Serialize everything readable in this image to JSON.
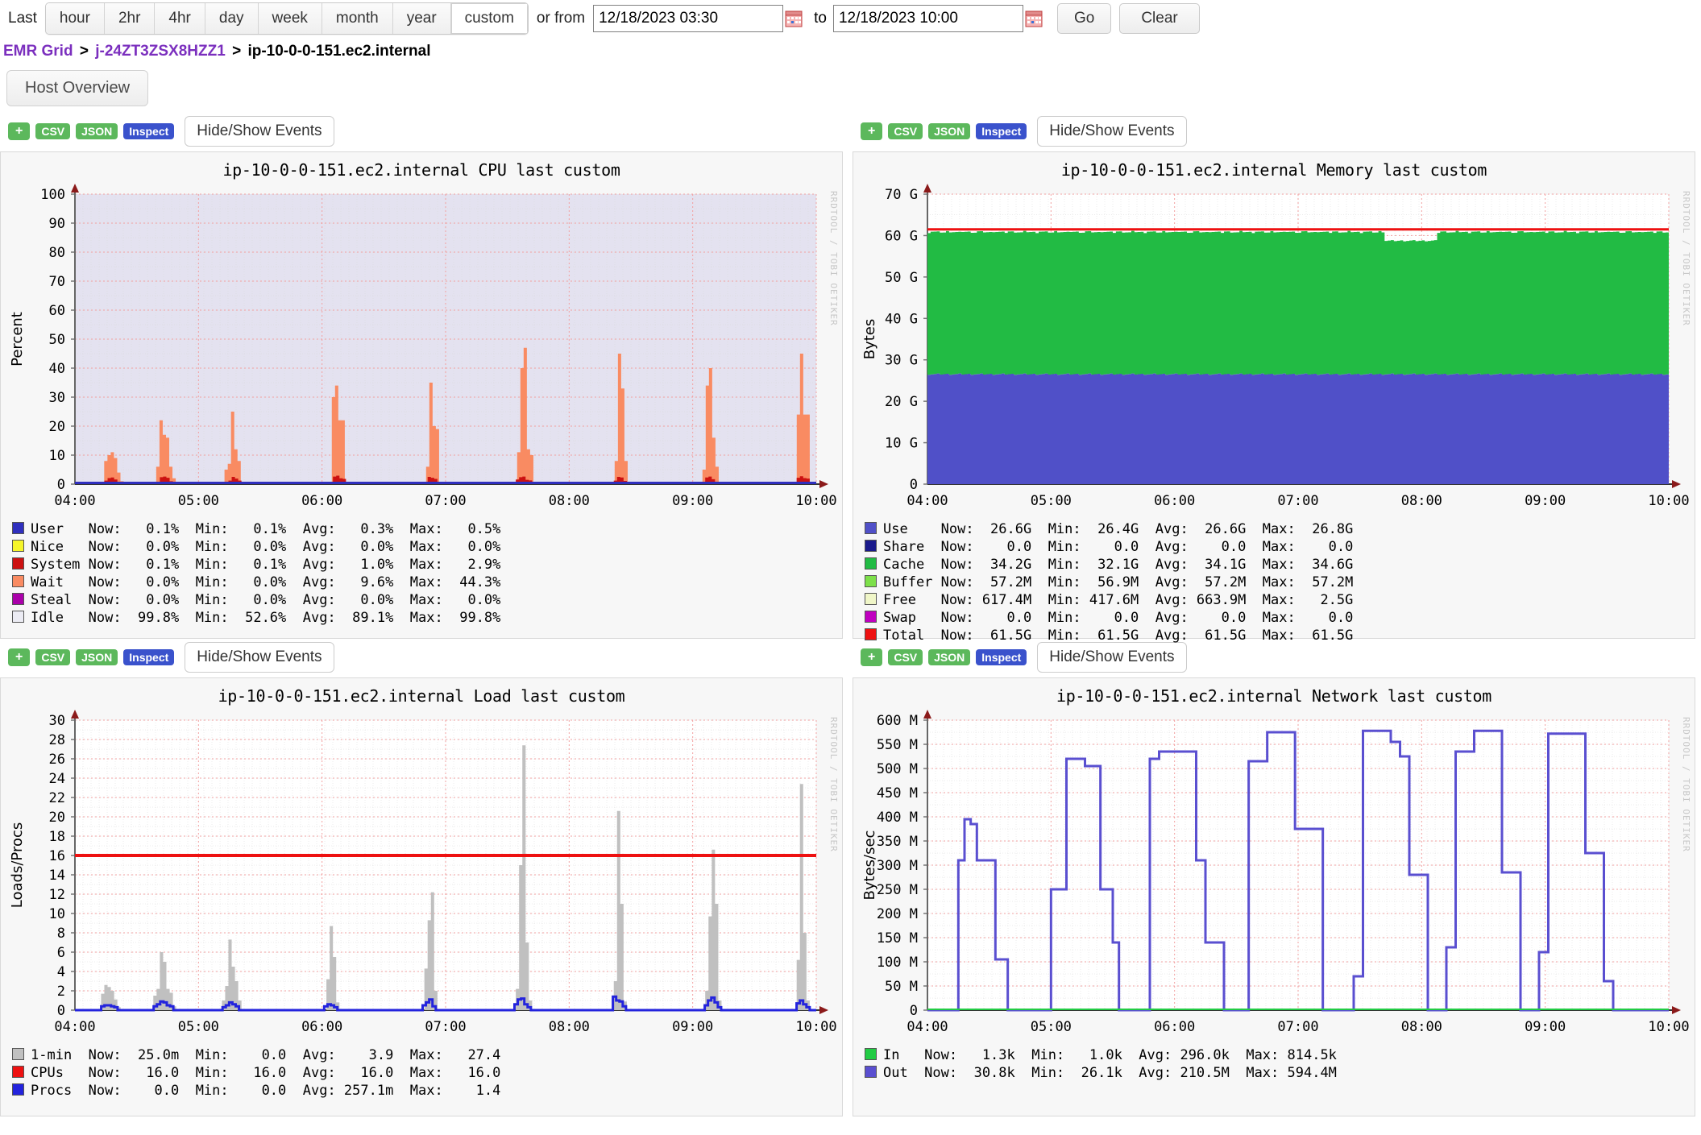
{
  "toolbar": {
    "last_label": "Last",
    "ranges": [
      {
        "id": "hour",
        "label": "hour",
        "active": false
      },
      {
        "id": "2hr",
        "label": "2hr",
        "active": false
      },
      {
        "id": "4hr",
        "label": "4hr",
        "active": false
      },
      {
        "id": "day",
        "label": "day",
        "active": false
      },
      {
        "id": "week",
        "label": "week",
        "active": false
      },
      {
        "id": "month",
        "label": "month",
        "active": false
      },
      {
        "id": "year",
        "label": "year",
        "active": false
      },
      {
        "id": "custom",
        "label": "custom",
        "active": true
      }
    ],
    "or_from_label": "or from",
    "from_value": "12/18/2023 03:30",
    "from_placeholder": "mm/dd/yyyy hh:mm",
    "to_label": "to",
    "to_value": "12/18/2023 10:00",
    "to_placeholder": "mm/dd/yyyy hh:mm",
    "go_label": "Go",
    "clear_label": "Clear",
    "calendar_icon": "calendar-icon"
  },
  "breadcrumb": {
    "grid": "EMR Grid",
    "cluster": "j-24ZT3ZSX8HZZ1",
    "host": "ip-10-0-0-151.ec2.internal",
    "separator": ">"
  },
  "tabs": [
    {
      "id": "host-overview",
      "label": "Host Overview",
      "active": true
    }
  ],
  "graph_toolbar": {
    "plus_label": "+",
    "csv_label": "CSV",
    "json_label": "JSON",
    "inspect_label": "Inspect",
    "events_label": "Hide/Show Events"
  },
  "rrd_credit": "RRDTOOL / TOBI OETIKER",
  "chart_data": [
    {
      "id": "cpu",
      "type": "area",
      "title": "ip-10-0-0-151.ec2.internal CPU last custom",
      "xlabel": "",
      "ylabel": "Percent",
      "ylim": [
        0,
        100
      ],
      "yticks": [
        0,
        10,
        20,
        30,
        40,
        50,
        60,
        70,
        80,
        90,
        100
      ],
      "xticks": [
        "04:00",
        "05:00",
        "06:00",
        "07:00",
        "08:00",
        "09:00",
        "10:00"
      ],
      "grid": true,
      "plot_bg": "#e4e2f0",
      "series": [
        {
          "name": "User",
          "color": "#2f2fbe",
          "now": "0.1%",
          "min": "0.1%",
          "avg": "0.3%",
          "max": "0.5%"
        },
        {
          "name": "Nice",
          "color": "#f5f52a",
          "now": "0.0%",
          "min": "0.0%",
          "avg": "0.0%",
          "max": "0.0%"
        },
        {
          "name": "System",
          "color": "#cc1111",
          "now": "0.1%",
          "min": "0.1%",
          "avg": "1.0%",
          "max": "2.9%"
        },
        {
          "name": "Wait",
          "color": "#f98b62",
          "now": "0.0%",
          "min": "0.0%",
          "avg": "9.6%",
          "max": "44.3%"
        },
        {
          "name": "Steal",
          "color": "#aa00aa",
          "now": "0.0%",
          "min": "0.0%",
          "avg": "0.0%",
          "max": "0.0%"
        },
        {
          "name": "Idle",
          "color": "#ececf4",
          "now": "99.8%",
          "min": "52.6%",
          "avg": "89.1%",
          "max": "99.8%"
        }
      ],
      "wait_values": [
        0,
        0,
        0,
        0,
        0,
        0,
        0,
        0,
        0,
        8,
        10,
        11,
        9,
        4,
        1,
        0,
        0,
        0,
        0,
        0,
        0,
        0,
        0,
        0,
        0,
        6,
        22,
        17,
        16,
        6,
        2,
        0,
        0,
        0,
        0,
        0,
        0,
        0,
        0,
        0,
        0,
        0,
        0,
        0,
        0,
        0,
        5,
        7,
        25,
        12,
        8,
        0,
        0,
        0,
        0,
        0,
        0,
        0,
        0,
        0,
        0,
        0,
        0,
        0,
        0,
        0,
        0,
        0,
        0,
        0,
        0,
        0,
        0,
        0,
        0,
        0,
        0,
        0,
        0,
        30,
        34,
        22,
        22,
        0,
        0,
        0,
        0,
        0,
        0,
        0,
        0,
        0,
        0,
        0,
        0,
        0,
        0,
        0,
        0,
        0,
        0,
        0,
        0,
        0,
        0,
        0,
        0,
        0,
        6,
        35,
        20,
        19,
        0,
        0,
        0,
        0,
        0,
        0,
        0,
        0,
        0,
        0,
        0,
        0,
        0,
        0,
        0,
        0,
        0,
        0,
        0,
        0,
        0,
        0,
        0,
        0,
        11,
        40,
        47,
        12,
        10,
        0,
        0,
        0,
        0,
        0,
        0,
        0,
        0,
        0,
        0,
        0,
        0,
        0,
        0,
        0,
        0,
        0,
        0,
        0,
        0,
        0,
        0,
        0,
        0,
        0,
        8,
        45,
        33,
        8,
        0,
        0,
        0,
        0,
        0,
        0,
        0,
        0,
        0,
        0,
        0,
        0,
        0,
        0,
        0,
        0,
        0,
        0,
        0,
        0,
        0,
        0,
        0,
        5,
        34,
        40,
        16,
        6,
        0,
        0,
        0,
        0,
        0,
        0,
        0,
        0,
        0,
        0,
        0,
        0,
        0,
        0,
        0,
        0,
        0,
        0,
        0,
        0,
        0,
        0,
        0,
        0,
        24,
        45,
        24,
        24,
        0,
        0
      ],
      "system_values": [
        0,
        0,
        0,
        0,
        0,
        0,
        0,
        0,
        0,
        1.2,
        2.1,
        2.3,
        1.6,
        0.8,
        0.3,
        0,
        0,
        0,
        0,
        0,
        0,
        0,
        0,
        0,
        0,
        0.8,
        2.4,
        2.6,
        2.2,
        1.0,
        0.4,
        0,
        0,
        0,
        0,
        0,
        0,
        0,
        0,
        0,
        0,
        0,
        0,
        0,
        0,
        0,
        0.7,
        1.2,
        2.5,
        1.9,
        1.2,
        0,
        0,
        0,
        0,
        0,
        0,
        0,
        0,
        0,
        0,
        0,
        0,
        0,
        0,
        0,
        0,
        0,
        0,
        0,
        0,
        0,
        0,
        0,
        0,
        0,
        0,
        0,
        0,
        2.6,
        2.9,
        2.0,
        1.8,
        0,
        0,
        0,
        0,
        0,
        0,
        0,
        0,
        0,
        0,
        0,
        0,
        0,
        0,
        0,
        0,
        0,
        0,
        0,
        0,
        0,
        0,
        0,
        0,
        0.7,
        2.5,
        2.2,
        1.8,
        0,
        0,
        0,
        0,
        0,
        0,
        0,
        0,
        0,
        0,
        0,
        0,
        0,
        0,
        0,
        0,
        0,
        0,
        0,
        0,
        0,
        0,
        0,
        0,
        1.6,
        2.4,
        2.6,
        1.5,
        1.3,
        0,
        0,
        0,
        0,
        0,
        0,
        0,
        0,
        0,
        0,
        0,
        0,
        0,
        0,
        0,
        0,
        0,
        0,
        0,
        0,
        0,
        0,
        0,
        0,
        0,
        1.2,
        2.5,
        2.3,
        1.1,
        0,
        0,
        0,
        0,
        0,
        0,
        0,
        0,
        0,
        0,
        0,
        0,
        0,
        0,
        0,
        0,
        0,
        0,
        0,
        0,
        0,
        0,
        0,
        0.6,
        2.3,
        2.6,
        1.7,
        0.8,
        0,
        0,
        0,
        0,
        0,
        0,
        0,
        0,
        0,
        0,
        0,
        0,
        0,
        0,
        0,
        0,
        0,
        0,
        0,
        0,
        0,
        0,
        0,
        0,
        2.2,
        2.7,
        2.1,
        1.9,
        0,
        0
      ]
    },
    {
      "id": "memory",
      "type": "area",
      "title": "ip-10-0-0-151.ec2.internal Memory last custom",
      "xlabel": "",
      "ylabel": "Bytes",
      "ylim": [
        0,
        70
      ],
      "yticks": [
        "0",
        "10 G",
        "20 G",
        "30 G",
        "40 G",
        "50 G",
        "60 G",
        "70 G"
      ],
      "xticks": [
        "04:00",
        "05:00",
        "06:00",
        "07:00",
        "08:00",
        "09:00",
        "10:00"
      ],
      "grid": true,
      "plot_bg": "#ffffff",
      "stack": {
        "use_g": 26.6,
        "cache_g": 34.2,
        "buffer_g": 0.057,
        "total_line_g": 61.5
      },
      "series": [
        {
          "name": "Use",
          "color": "#5050c8",
          "now": "26.6G",
          "min": "26.4G",
          "avg": "26.6G",
          "max": "26.8G"
        },
        {
          "name": "Share",
          "color": "#1a1a8c",
          "now": "0.0",
          "min": "0.0",
          "avg": "0.0",
          "max": "0.0"
        },
        {
          "name": "Cache",
          "color": "#22bb44",
          "now": "34.2G",
          "min": "32.1G",
          "avg": "34.1G",
          "max": "34.6G"
        },
        {
          "name": "Buffer",
          "color": "#7de04a",
          "now": "57.2M",
          "min": "56.9M",
          "avg": "57.2M",
          "max": "57.2M"
        },
        {
          "name": "Free",
          "color": "#f0f6c8",
          "now": "617.4M",
          "min": "417.6M",
          "avg": "663.9M",
          "max": "2.5G"
        },
        {
          "name": "Swap",
          "color": "#c000c0",
          "now": "0.0",
          "min": "0.0",
          "avg": "0.0",
          "max": "0.0"
        },
        {
          "name": "Total",
          "color": "#ee1111",
          "now": "61.5G",
          "min": "61.5G",
          "avg": "61.5G",
          "max": "61.5G"
        }
      ]
    },
    {
      "id": "load",
      "type": "area",
      "title": "ip-10-0-0-151.ec2.internal Load last custom",
      "xlabel": "",
      "ylabel": "Loads/Procs",
      "ylim": [
        0,
        30
      ],
      "yticks": [
        0,
        2,
        4,
        6,
        8,
        10,
        12,
        14,
        16,
        18,
        20,
        22,
        24,
        26,
        28,
        30
      ],
      "xticks": [
        "04:00",
        "05:00",
        "06:00",
        "07:00",
        "08:00",
        "09:00",
        "10:00"
      ],
      "grid": true,
      "plot_bg": "#ffffff",
      "cpus_line": 16.0,
      "series": [
        {
          "name": "1-min",
          "color": "#c0c0c0",
          "now": "25.0m",
          "min": "0.0",
          "avg": "3.9",
          "max": "27.4"
        },
        {
          "name": "CPUs",
          "color": "#ee1111",
          "now": "16.0",
          "min": "16.0",
          "avg": "16.0",
          "max": "16.0"
        },
        {
          "name": "Procs",
          "color": "#2323dd",
          "now": "0.0",
          "min": "0.0",
          "avg": "257.1m",
          "max": "1.4"
        }
      ],
      "load_values": [
        0,
        0,
        0,
        0,
        0,
        0,
        0,
        0,
        1.7,
        2.6,
        2.4,
        2.0,
        1.1,
        0.3,
        0,
        0,
        0,
        0,
        0,
        0,
        0,
        0,
        0,
        0,
        1.5,
        2.2,
        6.0,
        5.0,
        2.2,
        1.8,
        0.4,
        0,
        0,
        0,
        0,
        0,
        0,
        0,
        0,
        0,
        0,
        0,
        0,
        0,
        0,
        1.0,
        2.5,
        7.3,
        4.5,
        3.0,
        1.0,
        0,
        0,
        0,
        0,
        0,
        0,
        0,
        0,
        0,
        0,
        0,
        0,
        0,
        0,
        0,
        0,
        0,
        0,
        0,
        0,
        0,
        0,
        0,
        0,
        0,
        0,
        3.2,
        8.7,
        5.5,
        0.8,
        0,
        0,
        0,
        0,
        0,
        0,
        0,
        0,
        0,
        0,
        0,
        0,
        0,
        0,
        0,
        0,
        0,
        0,
        0,
        0,
        0,
        0,
        0,
        0,
        0,
        0,
        4.3,
        9.3,
        12.2,
        2.0,
        0,
        0,
        0,
        0,
        0,
        0,
        0,
        0,
        0,
        0,
        0,
        0,
        0,
        0,
        0,
        0,
        0,
        0,
        0,
        0,
        0,
        0,
        0,
        0,
        2.2,
        15.0,
        27.4,
        7.0,
        1.0,
        0,
        0,
        0,
        0,
        0,
        0,
        0,
        0,
        0,
        0,
        0,
        0,
        0,
        0,
        0,
        0,
        0,
        0,
        0,
        0,
        0,
        0,
        0,
        0,
        0,
        3.0,
        20.6,
        11.0,
        0.9,
        0,
        0,
        0,
        0,
        0,
        0,
        0,
        0,
        0,
        0,
        0,
        0,
        0,
        0,
        0,
        0,
        0,
        0,
        0,
        0,
        0,
        0,
        0,
        0,
        2.0,
        9.7,
        16.6,
        11.0,
        1.0,
        0,
        0,
        0,
        0,
        0,
        0,
        0,
        0,
        0,
        0,
        0,
        0,
        0,
        0,
        0,
        0,
        0,
        0,
        0,
        0,
        0,
        0,
        0,
        5.2,
        23.4,
        8.0,
        1.0,
        0,
        0
      ],
      "procs_values": [
        0,
        0,
        0,
        0,
        0,
        0,
        0,
        0,
        0.4,
        0.5,
        0.5,
        0.4,
        0.3,
        0,
        0,
        0,
        0,
        0,
        0,
        0,
        0,
        0,
        0,
        0,
        0.4,
        0.6,
        0.9,
        0.8,
        0.5,
        0.4,
        0,
        0,
        0,
        0,
        0,
        0,
        0,
        0,
        0,
        0,
        0,
        0,
        0,
        0,
        0,
        0.3,
        0.5,
        0.8,
        0.6,
        0.4,
        0,
        0,
        0,
        0,
        0,
        0,
        0,
        0,
        0,
        0,
        0,
        0,
        0,
        0,
        0,
        0,
        0,
        0,
        0,
        0,
        0,
        0,
        0,
        0,
        0,
        0,
        0.4,
        0.6,
        0.5,
        0.3,
        0,
        0,
        0,
        0,
        0,
        0,
        0,
        0,
        0,
        0,
        0,
        0,
        0,
        0,
        0,
        0,
        0,
        0,
        0,
        0,
        0,
        0,
        0,
        0,
        0,
        0,
        0.5,
        0.8,
        1.1,
        0.4,
        0,
        0,
        0,
        0,
        0,
        0,
        0,
        0,
        0,
        0,
        0,
        0,
        0,
        0,
        0,
        0,
        0,
        0,
        0,
        0,
        0,
        0,
        0,
        0,
        0.6,
        1.1,
        1.2,
        0.6,
        0.3,
        0,
        0,
        0,
        0,
        0,
        0,
        0,
        0,
        0,
        0,
        0,
        0,
        0,
        0,
        0,
        0,
        0,
        0,
        0,
        0,
        0,
        0,
        0,
        0,
        0,
        1.4,
        1.0,
        0.9,
        0.4,
        0,
        0,
        0,
        0,
        0,
        0,
        0,
        0,
        0,
        0,
        0,
        0,
        0,
        0,
        0,
        0,
        0,
        0,
        0,
        0,
        0,
        0,
        0,
        0,
        0.5,
        1.0,
        1.3,
        0.8,
        0.3,
        0,
        0,
        0,
        0,
        0,
        0,
        0,
        0,
        0,
        0,
        0,
        0,
        0,
        0,
        0,
        0,
        0,
        0,
        0,
        0,
        0,
        0,
        0,
        0.7,
        1.0,
        0.6,
        0.3,
        0,
        0
      ]
    },
    {
      "id": "network",
      "type": "line",
      "title": "ip-10-0-0-151.ec2.internal Network last custom",
      "xlabel": "",
      "ylabel": "Bytes/sec",
      "ylim": [
        0,
        600
      ],
      "yticks": [
        "0",
        "50 M",
        "100 M",
        "150 M",
        "200 M",
        "250 M",
        "300 M",
        "350 M",
        "400 M",
        "450 M",
        "500 M",
        "550 M",
        "600 M"
      ],
      "xticks": [
        "04:00",
        "05:00",
        "06:00",
        "07:00",
        "08:00",
        "09:00",
        "10:00"
      ],
      "grid": true,
      "plot_bg": "#ffffff",
      "series": [
        {
          "name": "In",
          "color": "#22cc44",
          "now": "1.3k",
          "min": "1.0k",
          "avg": "296.0k",
          "max": "814.5k"
        },
        {
          "name": "Out",
          "color": "#5a4fd0",
          "now": "30.8k",
          "min": "26.1k",
          "avg": "210.5M",
          "max": "594.4M"
        }
      ],
      "out_values": [
        0,
        0,
        0,
        0,
        0,
        0,
        0,
        0,
        310,
        395,
        385,
        310,
        310,
        105,
        0,
        0,
        0,
        0,
        0,
        0,
        0,
        0,
        0,
        250,
        250,
        520,
        520,
        505,
        250,
        250,
        140,
        0,
        0,
        0,
        0,
        0,
        0,
        0,
        0,
        0,
        0,
        0,
        520,
        535,
        535,
        535,
        310,
        140,
        140,
        0,
        0,
        0,
        0,
        0,
        0,
        0,
        0,
        0,
        0,
        0,
        515,
        515,
        575,
        575,
        375,
        375,
        0,
        0,
        0,
        0,
        0,
        0,
        0,
        0,
        0,
        70,
        70,
        578,
        578,
        555,
        525,
        280,
        280,
        0,
        0,
        0,
        0,
        0,
        0,
        0,
        0,
        0,
        0,
        0,
        0,
        0,
        0,
        130,
        130,
        535,
        535,
        578,
        578,
        578,
        285,
        285,
        0,
        0,
        0,
        0,
        0,
        0,
        0,
        0,
        0,
        0,
        0,
        0,
        0,
        0,
        0,
        0,
        0,
        0,
        0,
        0,
        0,
        0,
        0,
        0,
        0,
        0,
        0,
        0,
        0,
        0,
        0,
        0,
        0,
        0,
        0,
        0,
        0,
        0,
        0,
        0,
        0,
        0,
        0,
        0,
        0,
        0,
        0,
        0,
        0,
        0,
        0,
        0,
        0,
        0,
        0,
        0,
        0,
        0,
        0,
        0,
        0,
        0,
        0,
        0,
        0,
        0,
        0
      ]
    }
  ]
}
